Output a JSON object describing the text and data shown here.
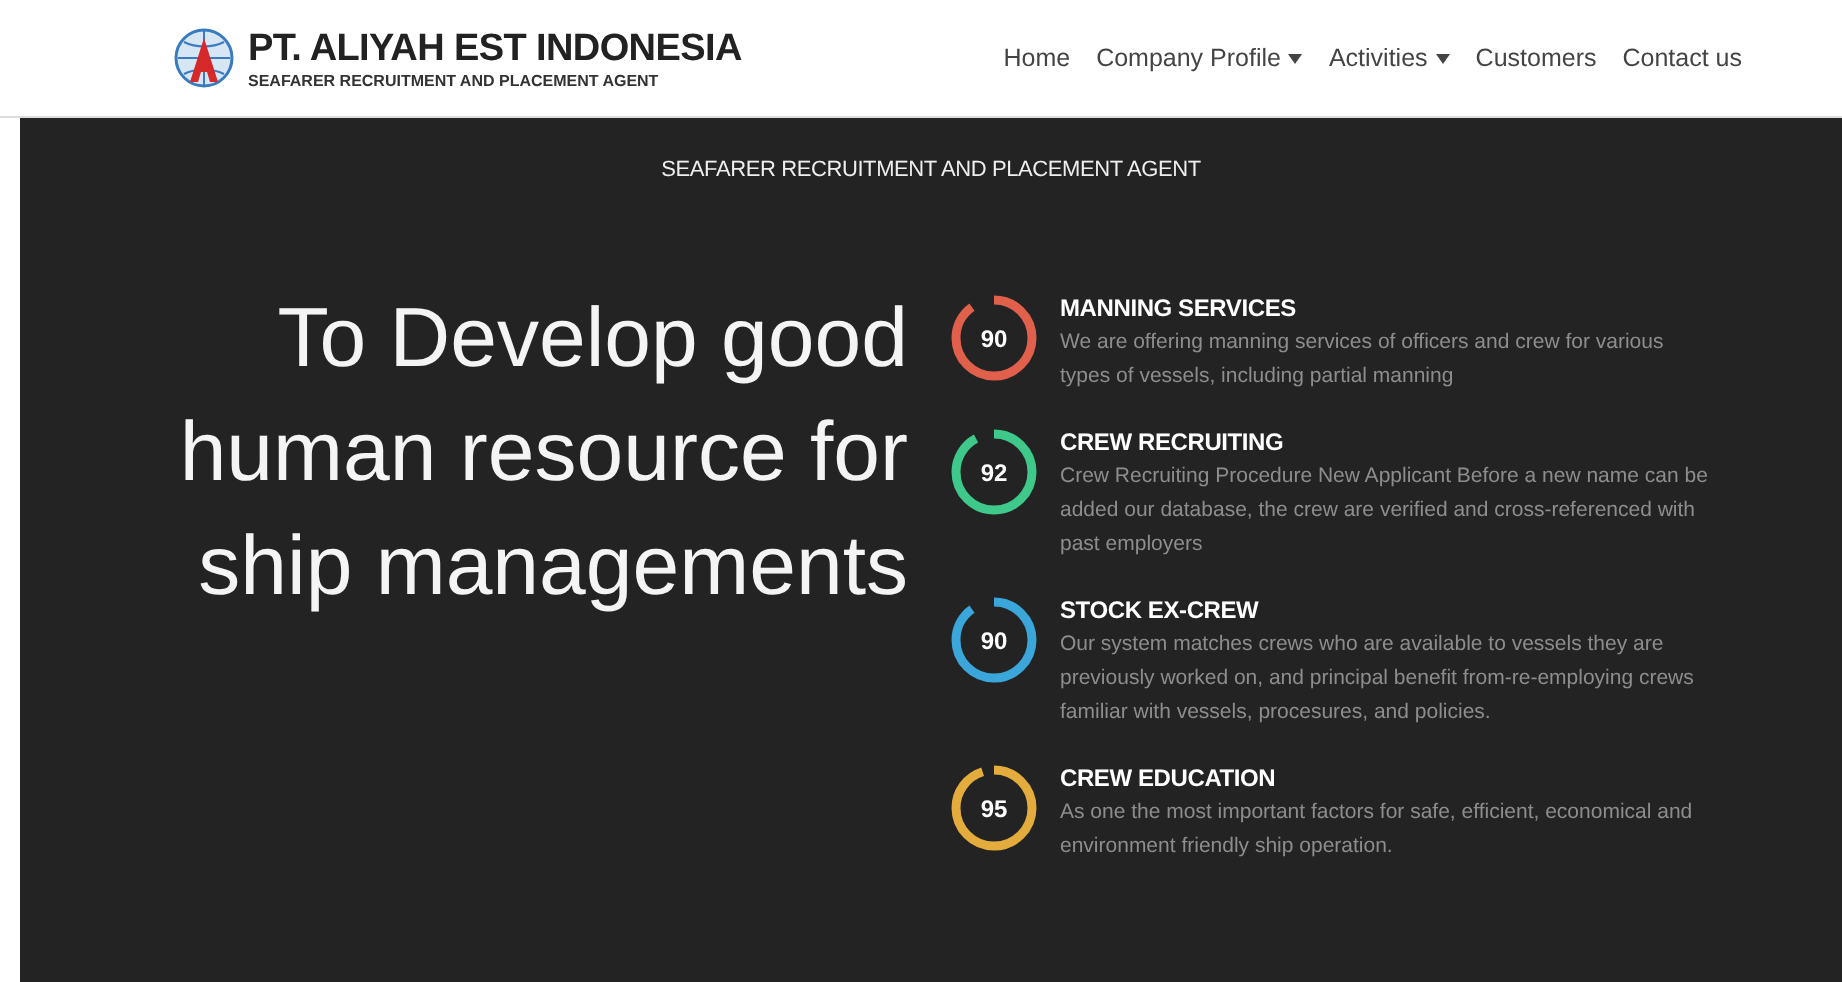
{
  "header": {
    "company_name": "PT. ALIYAH EST INDONESIA",
    "tagline": "SEAFARER RECRUITMENT AND PLACEMENT AGENT"
  },
  "nav": [
    {
      "label": "Home",
      "dropdown": false
    },
    {
      "label": "Company Profile",
      "dropdown": true
    },
    {
      "label": "Activities",
      "dropdown": true
    },
    {
      "label": "Customers",
      "dropdown": false
    },
    {
      "label": "Contact us",
      "dropdown": false
    }
  ],
  "hero": {
    "subtitle": "SEAFARER RECRUITMENT AND PLACEMENT AGENT",
    "headline": "To Develop good human resource for ship managements"
  },
  "services": [
    {
      "value": "90",
      "level": 0.9,
      "color": "#e0604c",
      "title": "MANNING SERVICES",
      "description": "We are offering manning services of officers and crew for various types of vessels, including partial manning"
    },
    {
      "value": "92",
      "level": 0.92,
      "color": "#3ec98a",
      "title": "CREW RECRUITING",
      "description": "Crew Recruiting Procedure New Applicant Before a new name can be added our database, the crew are verified and cross-referenced with past employers"
    },
    {
      "value": "90",
      "level": 0.9,
      "color": "#3aa6da",
      "title": "STOCK EX-CREW",
      "description": "Our system matches crews who are available to vessels they are previously worked on, and principal benefit from-re-employing crews familiar with vessels, procesures, and policies."
    },
    {
      "value": "95",
      "level": 0.95,
      "color": "#e3ac3c",
      "title": "CREW EDUCATION",
      "description": "As one the most important factors for safe, efficient, economical and environment friendly ship operation."
    }
  ]
}
